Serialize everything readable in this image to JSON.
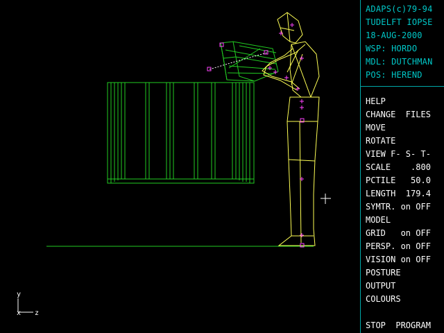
{
  "header": {
    "lines": [
      "ADAPS(c)79-94",
      "TUDELFT IOPSE",
      "18-AUG-2000",
      "WSP: HORDO",
      "MDL: DUTCHMAN",
      "POS: HEREND"
    ]
  },
  "menu": {
    "items": [
      "HELP",
      "CHANGE  FILES",
      "MOVE",
      "ROTATE",
      "VIEW F- S- T-",
      "SCALE    .800",
      "PCTILE   50.0",
      "LENGTH  179.4",
      "SYMTR. on OFF",
      "MODEL",
      "GRID   on OFF",
      "PERSP. on OFF",
      "VISION on OFF",
      "POSTURE",
      "OUTPUT",
      "COLOURS"
    ],
    "stop": "STOP  PROGRAM"
  },
  "axis": {
    "y": "y",
    "x": "x",
    "z": "z"
  },
  "colors": {
    "panel_border": "#00a8a8",
    "header_text": "#00c8c8",
    "menu_text": "#ffffff",
    "manikin": "#ffff55",
    "objects": "#22cc22",
    "joints": "#ff44ff"
  }
}
